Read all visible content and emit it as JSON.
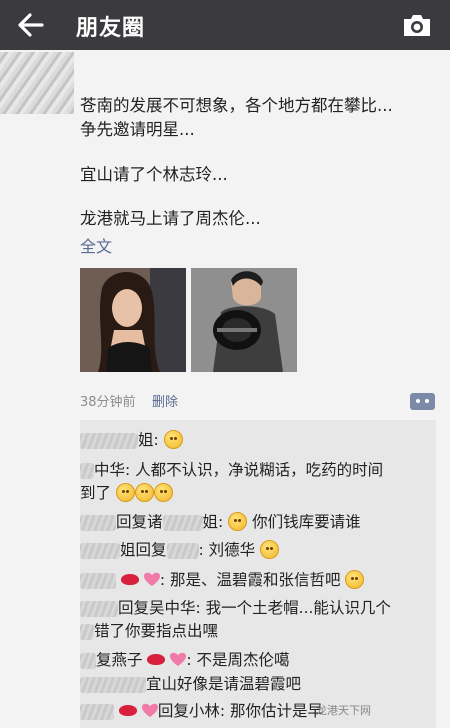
{
  "header": {
    "title": "朋友圈"
  },
  "post": {
    "line1": "苍南的发展不可想象，各个地方都在攀比...",
    "line2": "争先邀请明星...",
    "line3": "宜山请了个林志玲...",
    "line4": "龙港就马上请了周杰伦...",
    "full_text_link": "全文",
    "time": "38分钟前",
    "delete_label": "删除"
  },
  "comments": {
    "c1": "姐:",
    "c2a": "中华: 人都不认识，净说糊话，吃药的时间",
    "c2b": "到了",
    "c3a": "回复诸",
    "c3b": "姐:",
    "c3c": "你们钱库要请谁",
    "c4a": "姐回复",
    "c4b": ": 刘德华",
    "c5": ": 那是、温碧霞和张信哲吧",
    "c6a": "回复吴中华: 我一个土老帽...能认识几个",
    "c6b": "错了你要指点出嘿",
    "c7a": "复燕子",
    "c7b": ": 不是周杰伦噶",
    "c8": "宜山好像是请温碧霞吧",
    "c9a": "回复小林: 那你估计是早"
  },
  "watermark": "龙港天下网"
}
